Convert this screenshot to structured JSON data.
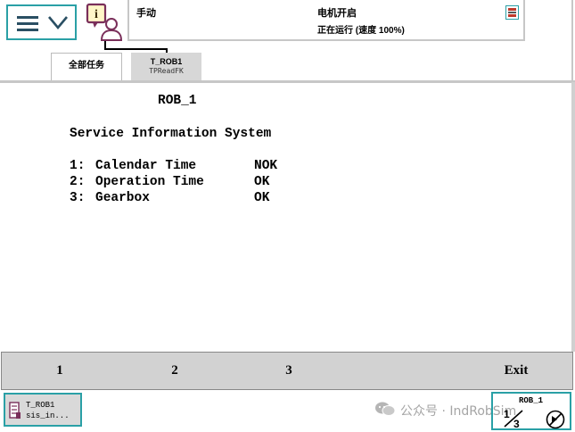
{
  "status_bar": {
    "mode": "手动",
    "motor_state": "电机开启",
    "run_state": "正在运行 (速度 100%)"
  },
  "tabs": [
    {
      "label": "全部任务"
    },
    {
      "title": "T_ROB1",
      "subtitle": "TPReadFK"
    }
  ],
  "screen": {
    "robot": "ROB_1",
    "heading": "Service Information System",
    "items": [
      {
        "index": "1:",
        "name": "Calendar Time",
        "status": "NOK"
      },
      {
        "index": "2:",
        "name": "Operation Time",
        "status": "OK"
      },
      {
        "index": "3:",
        "name": "Gearbox",
        "status": "OK"
      }
    ]
  },
  "function_keys": [
    "1",
    "2",
    "3",
    "",
    "Exit"
  ],
  "taskbar": {
    "window_title": "T_ROB1",
    "window_subtitle": "sis_in..."
  },
  "quickset": {
    "label": "ROB_1"
  },
  "watermark": "公众号 · IndRobSim",
  "icons": {
    "menu": "hamburger-icon",
    "menu_chevron": "chevron-down-icon",
    "status": "info-person-icon",
    "status_flag": "robot-status-flag-icon",
    "task": "program-window-icon",
    "quickset_fraction": "one-third-increment-icon",
    "quickset_stop": "stop-run-icon",
    "watermark_logo": "wechat-icon"
  },
  "colors": {
    "accent": "#2aa0a6",
    "panel_gray": "#d2d2d2",
    "tab_active": "#d7d7d7",
    "watermark": "#a5a5a5"
  }
}
